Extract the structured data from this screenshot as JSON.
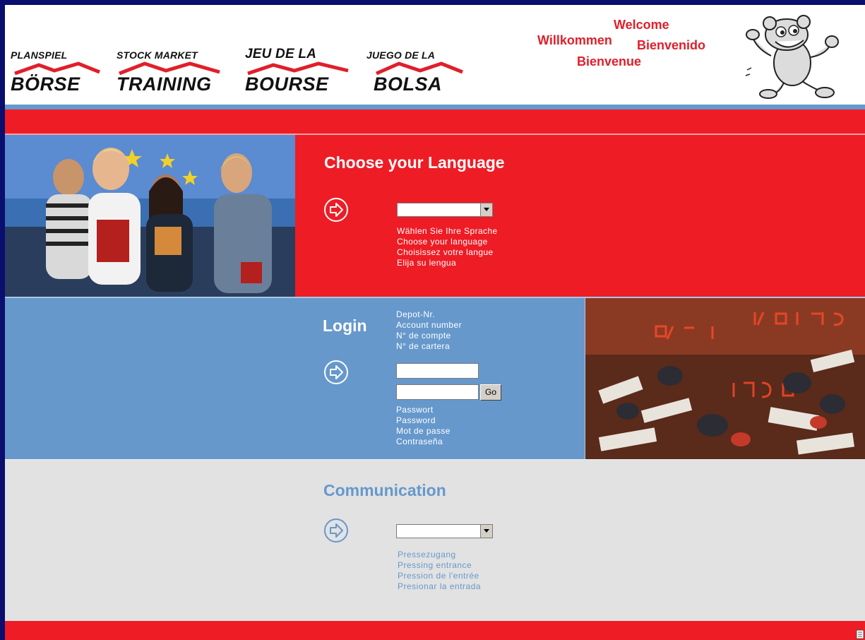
{
  "header": {
    "logos": [
      {
        "top": "PLANSPIEL",
        "bottom": "BÖRSE"
      },
      {
        "top": "STOCK MARKET",
        "bottom": "TRAINING"
      },
      {
        "top": "JEU DE LA",
        "bottom": "BOURSE"
      },
      {
        "top": "JUEGO DE LA",
        "bottom": "BOLSA"
      }
    ],
    "welcome": {
      "en": "Welcome",
      "de": "Willkommen",
      "es": "Bienvenido",
      "fr": "Bienvenue"
    }
  },
  "language": {
    "title": "Choose your Language",
    "select_value": "",
    "prompts": [
      "Wählen Sie Ihre Sprache",
      "Choose your language",
      "Choisissez votre langue",
      "Elija su lengua"
    ]
  },
  "login": {
    "title": "Login",
    "account_labels": [
      "Depot-Nr.",
      "Account number",
      "N° de compte",
      "N° de cartera"
    ],
    "account_value": "",
    "password_value": "",
    "go_label": "Go",
    "password_labels": [
      "Passwort",
      "Password",
      "Mot de passe",
      "Contraseña"
    ]
  },
  "communication": {
    "title": "Communication",
    "select_value": "",
    "options_labels": [
      "Pressezugang",
      "Pressing entrance",
      "Pression de l'entrée",
      "Presionar la entrada"
    ]
  },
  "colors": {
    "frame": "#0a0e6e",
    "red": "#ee1c25",
    "blue": "#6698cc",
    "grey": "#e2e2e2"
  }
}
